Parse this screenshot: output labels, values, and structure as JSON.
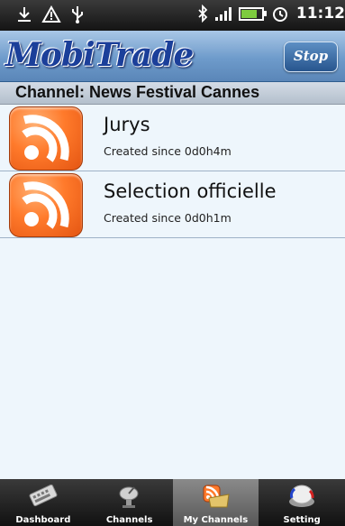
{
  "status_bar": {
    "time": "11:12",
    "icons": [
      "download-icon",
      "warning-icon",
      "usb-icon",
      "bluetooth-icon",
      "signal-icon",
      "battery-icon",
      "alarm-icon"
    ]
  },
  "app": {
    "logo_text": "MobiTrade",
    "stop_button_label": "Stop"
  },
  "channel_header": "Channel: News Festival Cannes",
  "channels": [
    {
      "title": "Jurys",
      "subtitle": "Created since 0d0h4m",
      "icon": "rss-icon"
    },
    {
      "title": "Selection officielle",
      "subtitle": "Created since 0d0h1m",
      "icon": "rss-icon"
    }
  ],
  "tabs": [
    {
      "label": "Dashboard",
      "icon": "keyboard-icon",
      "active": false
    },
    {
      "label": "Channels",
      "icon": "satellite-dish-icon",
      "active": false
    },
    {
      "label": "My Channels",
      "icon": "rss-folder-icon",
      "active": true
    },
    {
      "label": "Setting",
      "icon": "settings-knob-icon",
      "active": false
    }
  ],
  "colors": {
    "title_bar": "#6e9bcb",
    "logo": "#1b3f9a",
    "rss_orange": "#ff7a2b",
    "list_background": "#eef6fc",
    "tab_bar": "#141414",
    "tab_active": "#6e6e6e"
  }
}
